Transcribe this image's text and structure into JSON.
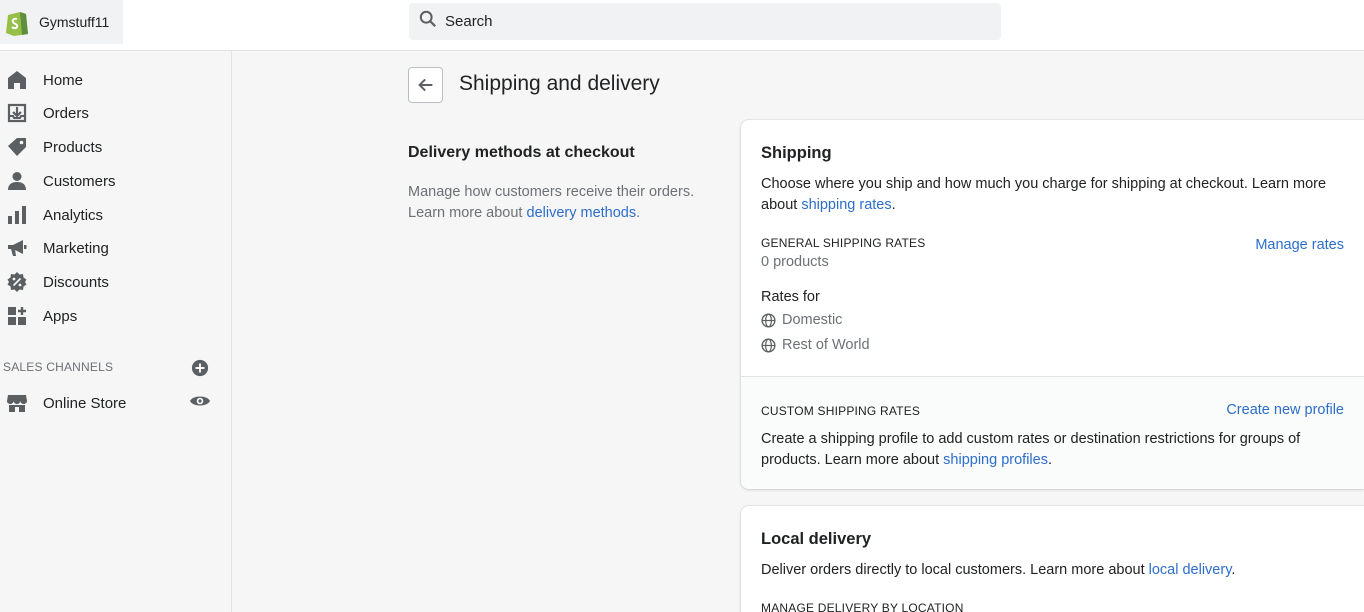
{
  "store": {
    "name": "Gymstuff11"
  },
  "search": {
    "placeholder": "Search"
  },
  "sidebar": {
    "items": [
      {
        "label": "Home",
        "icon": "home-icon"
      },
      {
        "label": "Orders",
        "icon": "orders-icon"
      },
      {
        "label": "Products",
        "icon": "tag-icon"
      },
      {
        "label": "Customers",
        "icon": "person-icon"
      },
      {
        "label": "Analytics",
        "icon": "bar-chart-icon"
      },
      {
        "label": "Marketing",
        "icon": "megaphone-icon"
      },
      {
        "label": "Discounts",
        "icon": "discount-icon"
      },
      {
        "label": "Apps",
        "icon": "apps-icon"
      }
    ],
    "sales_channels_header": "SALES CHANNELS",
    "channels": [
      {
        "label": "Online Store",
        "icon": "store-icon"
      }
    ]
  },
  "page": {
    "title": "Shipping and delivery"
  },
  "annotation": {
    "title": "Delivery methods at checkout",
    "desc_text": "Manage how customers receive their orders. Learn more about ",
    "desc_link": "delivery methods",
    "desc_end": "."
  },
  "shipping_card": {
    "title": "Shipping",
    "desc_text": "Choose where you ship and how much you charge for shipping at checkout. Learn more about ",
    "desc_link": "shipping rates",
    "desc_end": ".",
    "general_header": "GENERAL SHIPPING RATES",
    "general_count": "0 products",
    "manage_rates": "Manage rates",
    "rates_for": "Rates for",
    "zones": [
      "Domestic",
      "Rest of World"
    ],
    "custom_header": "CUSTOM SHIPPING RATES",
    "create_profile": "Create new profile",
    "custom_desc_text": "Create a shipping profile to add custom rates or destination restrictions for groups of products. Learn more about ",
    "custom_desc_link": "shipping profiles",
    "custom_desc_end": "."
  },
  "local_card": {
    "title": "Local delivery",
    "desc_text": "Deliver orders directly to local customers. Learn more about ",
    "desc_link": "local delivery",
    "desc_end": ".",
    "manage_header": "MANAGE DELIVERY BY LOCATION"
  },
  "colors": {
    "brand_green": "#95bf47",
    "link_blue": "#2c6ecb",
    "icon_gray": "#5c5f62"
  }
}
